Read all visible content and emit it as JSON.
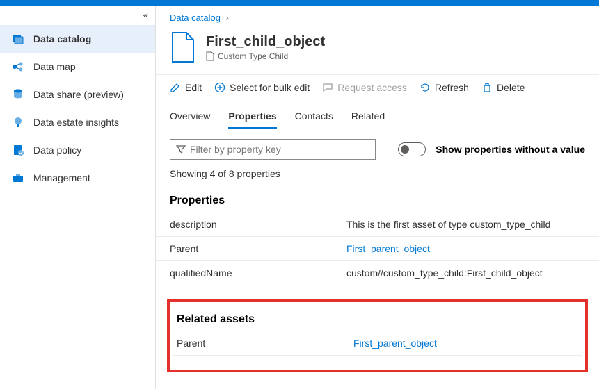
{
  "sidebar": {
    "items": [
      {
        "label": "Data catalog"
      },
      {
        "label": "Data map"
      },
      {
        "label": "Data share (preview)"
      },
      {
        "label": "Data estate insights"
      },
      {
        "label": "Data policy"
      },
      {
        "label": "Management"
      }
    ]
  },
  "breadcrumb": {
    "root": "Data catalog"
  },
  "asset": {
    "title": "First_child_object",
    "type": "Custom Type Child"
  },
  "toolbar": {
    "edit": "Edit",
    "bulk": "Select for bulk edit",
    "request": "Request access",
    "refresh": "Refresh",
    "delete": "Delete"
  },
  "tabs": {
    "overview": "Overview",
    "properties": "Properties",
    "contacts": "Contacts",
    "related": "Related"
  },
  "filter": {
    "placeholder": "Filter by property key",
    "toggle_label": "Show properties without a value",
    "showing": "Showing 4 of 8 properties"
  },
  "props": {
    "heading": "Properties",
    "rows": [
      {
        "k": "description",
        "v": "This is the first asset of type custom_type_child",
        "link": false
      },
      {
        "k": "Parent",
        "v": "First_parent_object",
        "link": true
      },
      {
        "k": "qualifiedName",
        "v": "custom//custom_type_child:First_child_object",
        "link": false
      }
    ]
  },
  "related": {
    "heading": "Related assets",
    "rows": [
      {
        "k": "Parent",
        "v": "First_parent_object",
        "link": true
      }
    ]
  }
}
